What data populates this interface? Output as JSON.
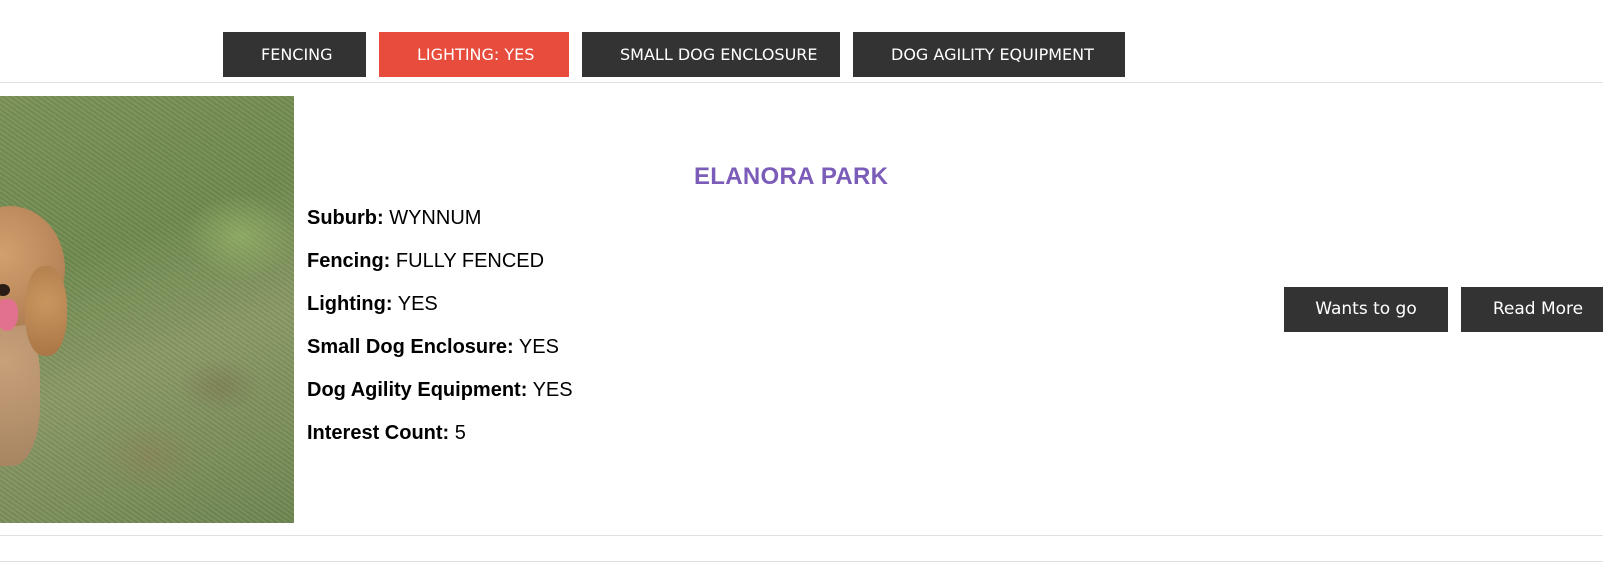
{
  "filters": [
    {
      "label": "FENCING",
      "active": false
    },
    {
      "label": "LIGHTING: YES",
      "active": true
    },
    {
      "label": "SMALL DOG ENCLOSURE",
      "active": false
    },
    {
      "label": "DOG AGILITY EQUIPMENT",
      "active": false
    }
  ],
  "colors": {
    "button_bg": "#333333",
    "active_filter_bg": "#e74c3c",
    "title_color": "#7b5cb8"
  },
  "park": {
    "title": "ELANORA PARK",
    "image_alt": "dog-photo",
    "details": [
      {
        "key": "Suburb:",
        "value": "WYNNUM"
      },
      {
        "key": "Fencing:",
        "value": "FULLY FENCED"
      },
      {
        "key": "Lighting:",
        "value": "YES"
      },
      {
        "key": "Small Dog Enclosure:",
        "value": "YES"
      },
      {
        "key": "Dog Agility Equipment:",
        "value": "YES"
      },
      {
        "key": "Interest Count:",
        "value": "5"
      }
    ],
    "actions": {
      "wants_to_go": "Wants to go",
      "read_more": "Read More"
    }
  }
}
